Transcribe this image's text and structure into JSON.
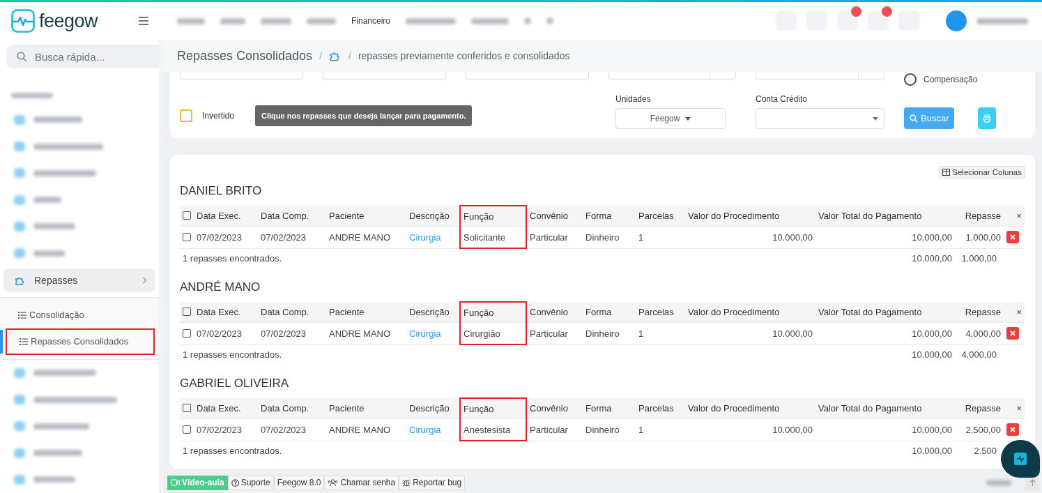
{
  "header": {
    "logo_text": "feegow",
    "nav_item": "Financeiro"
  },
  "sidebar": {
    "search_placeholder": "Busca rápida...",
    "menu": [
      {
        "label": "Repasses",
        "expanded": true,
        "children": [
          {
            "label": "Consolidação",
            "selected": false,
            "highlighted": false
          },
          {
            "label": "Repasses Consolidados",
            "selected": true,
            "highlighted": true
          }
        ]
      }
    ]
  },
  "breadcrumb": {
    "title": "Repasses Consolidados",
    "separators": [
      "/",
      "/"
    ],
    "page": "repasses previamente conferidos e consolidados"
  },
  "filters": {
    "compensacao": {
      "label": "Compensação",
      "selected": false
    },
    "invertido": {
      "label": "Invertido",
      "checked": false
    },
    "hint": "Clique nos repasses que deseja lançar para pagamento.",
    "unidades": {
      "label": "Unidades",
      "value": "Feegow"
    },
    "conta_credito": {
      "label": "Conta Crédito"
    },
    "search_button": "Buscar"
  },
  "select_columns_button": "Selecionar Colunas",
  "groups": [
    {
      "name": "DANIEL BRITO",
      "header_checked": false,
      "columns": [
        {
          "label": "Data Exec.",
          "highlighted": false
        },
        {
          "label": "Data Comp.",
          "highlighted": false
        },
        {
          "label": "Paciente",
          "highlighted": false
        },
        {
          "label": "Descrição",
          "highlighted": false
        },
        {
          "label": "Função",
          "highlighted": true
        },
        {
          "label": "Convênio",
          "highlighted": false
        },
        {
          "label": "Forma",
          "highlighted": false
        },
        {
          "label": "Parcelas",
          "highlighted": false
        },
        {
          "label": "Valor do Procedimento",
          "highlighted": false
        },
        {
          "label": "Valor Total do Pagamento",
          "highlighted": false
        },
        {
          "label": "Repasse",
          "highlighted": false
        }
      ],
      "close_label": "×",
      "rows": [
        {
          "checked": false,
          "cells": [
            "07/02/2023",
            "07/02/2023",
            "ANDRE MANO",
            "Cirurgia",
            "Solicitante",
            "Particular",
            "Dinheiro",
            "1",
            "10.000,00",
            "10.000,00",
            "1.000,00"
          ]
        }
      ],
      "summary": "1 repasses encontrados.",
      "total_valor": "10.000,00",
      "total_repasse": "1.000,00"
    },
    {
      "name": "ANDRÉ MANO",
      "header_checked": false,
      "columns": [
        {
          "label": "Data Exec.",
          "highlighted": false
        },
        {
          "label": "Data Comp.",
          "highlighted": false
        },
        {
          "label": "Paciente",
          "highlighted": false
        },
        {
          "label": "Descrição",
          "highlighted": false
        },
        {
          "label": "Função",
          "highlighted": true
        },
        {
          "label": "Convênio",
          "highlighted": false
        },
        {
          "label": "Forma",
          "highlighted": false
        },
        {
          "label": "Parcelas",
          "highlighted": false
        },
        {
          "label": "Valor do Procedimento",
          "highlighted": false
        },
        {
          "label": "Valor Total do Pagamento",
          "highlighted": false
        },
        {
          "label": "Repasse",
          "highlighted": false
        }
      ],
      "close_label": "×",
      "rows": [
        {
          "checked": false,
          "cells": [
            "07/02/2023",
            "07/02/2023",
            "ANDRE MANO",
            "Cirurgia",
            "Cirurgião",
            "Particular",
            "Dinheiro",
            "1",
            "10.000,00",
            "10.000,00",
            "4.000,00"
          ]
        }
      ],
      "summary": "1 repasses encontrados.",
      "total_valor": "10.000,00",
      "total_repasse": "4.000,00"
    },
    {
      "name": "GABRIEL OLIVEIRA",
      "header_checked": false,
      "columns": [
        {
          "label": "Data Exec.",
          "highlighted": false
        },
        {
          "label": "Data Comp.",
          "highlighted": false
        },
        {
          "label": "Paciente",
          "highlighted": false
        },
        {
          "label": "Descrição",
          "highlighted": false
        },
        {
          "label": "Função",
          "highlighted": true
        },
        {
          "label": "Convênio",
          "highlighted": false
        },
        {
          "label": "Forma",
          "highlighted": false
        },
        {
          "label": "Parcelas",
          "highlighted": false
        },
        {
          "label": "Valor do Procedimento",
          "highlighted": false
        },
        {
          "label": "Valor Total do Pagamento",
          "highlighted": false
        },
        {
          "label": "Repasse",
          "highlighted": false
        }
      ],
      "close_label": "×",
      "rows": [
        {
          "checked": false,
          "cells": [
            "07/02/2023",
            "07/02/2023",
            "ANDRE MANO",
            "Cirurgia",
            "Anestesista",
            "Particular",
            "Dinheiro",
            "1",
            "10.000,00",
            "10.000,00",
            "2.500,00"
          ]
        }
      ],
      "summary": "1 repasses encontrados.",
      "total_valor": "10.000,00",
      "total_repasse": "2.500"
    }
  ],
  "footer": {
    "items": [
      {
        "label": "Vídeo-aula",
        "kind": "video"
      },
      {
        "label": "Suporte",
        "kind": "help"
      },
      {
        "label": "Feegow 8.0",
        "kind": "plain"
      },
      {
        "label": "Chamar senha",
        "kind": "people"
      },
      {
        "label": "Reportar bug",
        "kind": "bug"
      }
    ]
  }
}
